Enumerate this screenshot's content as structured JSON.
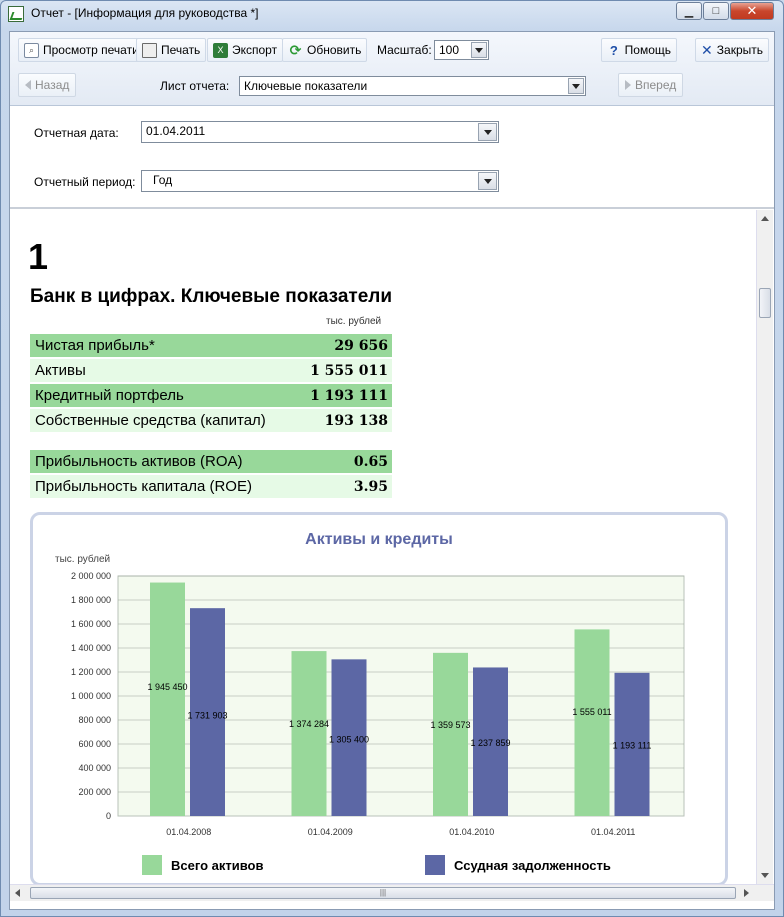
{
  "window": {
    "title": "Отчет - [Информация для руководства *]",
    "min_label": "▁",
    "max_label": "□",
    "close_label": "✕"
  },
  "toolbar": {
    "preview_label": "Просмотр печати",
    "print_label": "Печать",
    "export_label": "Экспорт",
    "refresh_label": "Обновить",
    "scale_label": "Масштаб:",
    "scale_value": "100",
    "help_label": "Помощь",
    "close_label": "Закрыть",
    "back_label": "Назад",
    "forward_label": "Вперед",
    "sheet_label": "Лист отчета:",
    "sheet_value": "Ключевые показатели"
  },
  "params": {
    "date_label": "Отчетная дата:",
    "date_value": "01.04.2011",
    "period_label": "Отчетный период:",
    "period_value": "Год"
  },
  "report": {
    "page_number": "1",
    "heading": "Банк в цифрах. Ключевые показатели",
    "unit": "тыс. рублей",
    "kpis": [
      {
        "label": "Чистая прибыль*",
        "value": "29 656"
      },
      {
        "label": "Активы",
        "value": "1 555 011"
      },
      {
        "label": "Кредитный портфель",
        "value": "1 193 111"
      },
      {
        "label": "Собственные средства (капитал)",
        "value": "193 138"
      }
    ],
    "ratios": [
      {
        "label": "Прибыльность активов (ROA)",
        "value": "0.65"
      },
      {
        "label": "Прибыльность капитала (ROE)",
        "value": "3.95"
      }
    ]
  },
  "colors": {
    "assets": "#98d89a",
    "loans": "#5c67a5",
    "kpi_dark": "#98d89a",
    "kpi_light": "#e6fae6",
    "plot_bg": "#f4faef",
    "title": "#5c67a5"
  },
  "chart_data": {
    "type": "bar",
    "title": "Активы и кредиты",
    "ylabel": "тыс. рублей",
    "xlabel": "",
    "categories": [
      "01.04.2008",
      "01.04.2009",
      "01.04.2010",
      "01.04.2011"
    ],
    "series": [
      {
        "name": "Всего активов",
        "values": [
          1945450,
          1374284,
          1359573,
          1555011
        ],
        "labels": [
          "1 945 450",
          "1 374 284",
          "1 359 573",
          "1 555 011"
        ]
      },
      {
        "name": "Ссудная задолженность",
        "values": [
          1731903,
          1305400,
          1237859,
          1193111
        ],
        "labels": [
          "1 731 903",
          "1 305 400",
          "1 237 859",
          "1 193 111"
        ]
      }
    ],
    "ylim": [
      0,
      2000000
    ],
    "yticks": [
      "0",
      "200 000",
      "400 000",
      "600 000",
      "800 000",
      "1 000 000",
      "1 200 000",
      "1 400 000",
      "1 600 000",
      "1 800 000",
      "2 000 000"
    ],
    "grid": true,
    "legend": "bottom"
  }
}
